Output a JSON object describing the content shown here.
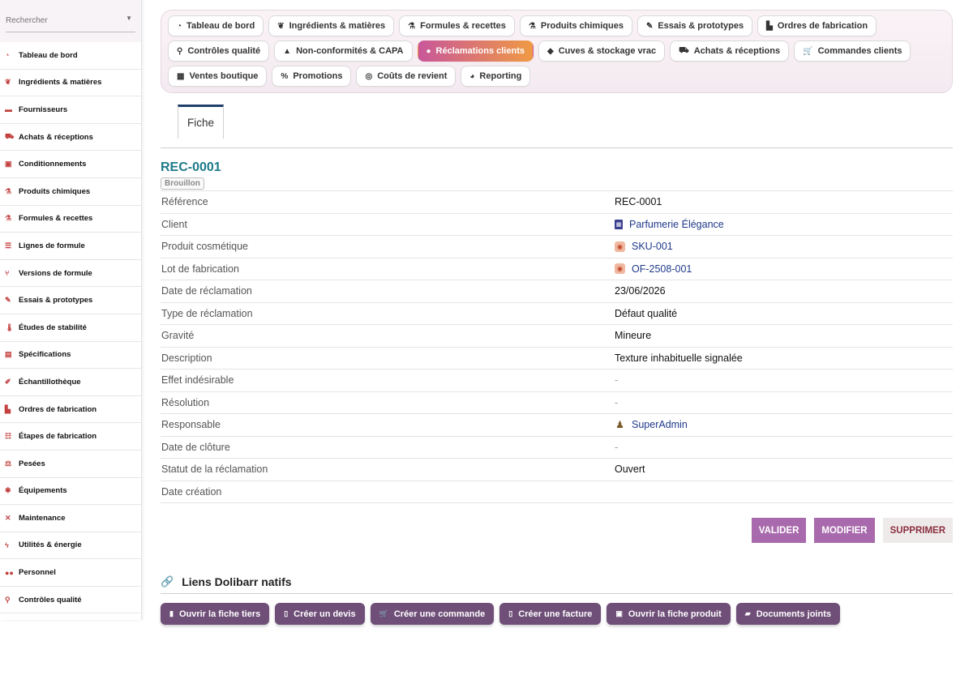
{
  "sidebar": {
    "search_placeholder": "Rechercher",
    "items": [
      {
        "label": "Tableau de bord",
        "icon": "dashboard-icon"
      },
      {
        "label": "Ingrédients & matières",
        "icon": "leaf-icon"
      },
      {
        "label": "Fournisseurs",
        "icon": "truck-icon"
      },
      {
        "label": "Achats & réceptions",
        "icon": "dolly-icon"
      },
      {
        "label": "Conditionnements",
        "icon": "box-icon"
      },
      {
        "label": "Produits chimiques",
        "icon": "flask-icon"
      },
      {
        "label": "Formules & recettes",
        "icon": "beaker-icon"
      },
      {
        "label": "Lignes de formule",
        "icon": "list-icon"
      },
      {
        "label": "Versions de formule",
        "icon": "branch-icon"
      },
      {
        "label": "Essais & prototypes",
        "icon": "eyedropper-icon"
      },
      {
        "label": "Études de stabilité",
        "icon": "thermometer-icon"
      },
      {
        "label": "Spécifications",
        "icon": "clipboard-icon"
      },
      {
        "label": "Échantillothèque",
        "icon": "vial-icon"
      },
      {
        "label": "Ordres de fabrication",
        "icon": "industry-icon"
      },
      {
        "label": "Étapes de fabrication",
        "icon": "steps-icon"
      },
      {
        "label": "Pesées",
        "icon": "scale-icon"
      },
      {
        "label": "Équipements",
        "icon": "cogs-icon"
      },
      {
        "label": "Maintenance",
        "icon": "tools-icon"
      },
      {
        "label": "Utilités & énergie",
        "icon": "bolt-icon"
      },
      {
        "label": "Personnel",
        "icon": "users-icon"
      },
      {
        "label": "Contrôles qualité",
        "icon": "microscope-icon"
      }
    ]
  },
  "tabs": {
    "row1": [
      {
        "label": "Tableau de bord",
        "icon": "dashboard-icon"
      },
      {
        "label": "Ingrédients & matières",
        "icon": "leaf-icon"
      },
      {
        "label": "Formules & recettes",
        "icon": "beaker-icon"
      },
      {
        "label": "Produits chimiques",
        "icon": "flask-icon"
      },
      {
        "label": "Essais & prototypes",
        "icon": "eyedropper-icon"
      },
      {
        "label": "Ordres de fabrication",
        "icon": "industry-icon"
      }
    ],
    "row2": [
      {
        "label": "Contrôles qualité",
        "icon": "microscope-icon"
      },
      {
        "label": "Non-conformités & CAPA",
        "icon": "warning-icon"
      },
      {
        "label": "Réclamations clients",
        "icon": "comment-icon",
        "active": true
      },
      {
        "label": "Cuves & stockage vrac",
        "icon": "fill-icon"
      },
      {
        "label": "Achats & réceptions",
        "icon": "dolly-icon"
      },
      {
        "label": "Commandes clients",
        "icon": "cart-icon"
      }
    ],
    "row3": [
      {
        "label": "Ventes boutique",
        "icon": "cash-register-icon"
      },
      {
        "label": "Promotions",
        "icon": "percent-icon"
      },
      {
        "label": "Coûts de revient",
        "icon": "coins-icon"
      },
      {
        "label": "Reporting",
        "icon": "pie-chart-icon"
      }
    ]
  },
  "card": {
    "tab_label": "Fiche",
    "ref_title": "REC-0001",
    "status": "Brouillon"
  },
  "fields": [
    {
      "label": "Référence",
      "value": "REC-0001",
      "kind": "text"
    },
    {
      "label": "Client",
      "value": "Parfumerie Élégance",
      "kind": "link",
      "icon": "building-icon"
    },
    {
      "label": "Produit cosmétique",
      "value": "SKU-001",
      "kind": "link",
      "icon": "product-icon"
    },
    {
      "label": "Lot de fabrication",
      "value": "OF-2508-001",
      "kind": "link",
      "icon": "product-icon"
    },
    {
      "label": "Date de réclamation",
      "value": "23/06/2026",
      "kind": "text"
    },
    {
      "label": "Type de réclamation",
      "value": "Défaut qualité",
      "kind": "text"
    },
    {
      "label": "Gravité",
      "value": "Mineure",
      "kind": "text"
    },
    {
      "label": "Description",
      "value": "Texture inhabituelle signalée",
      "kind": "text"
    },
    {
      "label": "Effet indésirable",
      "value": "-",
      "kind": "dash"
    },
    {
      "label": "Résolution",
      "value": "-",
      "kind": "dash"
    },
    {
      "label": "Responsable",
      "value": "SuperAdmin",
      "kind": "link",
      "icon": "user-icon"
    },
    {
      "label": "Date de clôture",
      "value": "-",
      "kind": "dash"
    },
    {
      "label": "Statut de la réclamation",
      "value": "Ouvert",
      "kind": "text"
    },
    {
      "label": "Date création",
      "value": "",
      "kind": "text"
    }
  ],
  "actions": {
    "validate": "VALIDER",
    "modify": "MODIFIER",
    "delete": "SUPPRIMER"
  },
  "native_links": {
    "title": "Liens Dolibarr natifs",
    "buttons": [
      {
        "label": "Ouvrir la fiche tiers",
        "icon": "building-icon"
      },
      {
        "label": "Créer un devis",
        "icon": "file-icon"
      },
      {
        "label": "Créer une commande",
        "icon": "cart-icon"
      },
      {
        "label": "Créer une facture",
        "icon": "invoice-icon"
      },
      {
        "label": "Ouvrir la fiche produit",
        "icon": "box-icon"
      },
      {
        "label": "Documents joints",
        "icon": "folder-icon"
      }
    ]
  },
  "colors": {
    "accent_gradient_start": "#c9579a",
    "accent_gradient_end": "#ef9a45",
    "ref_title": "#1e7a8a",
    "action_primary": "#a86aac",
    "link_button": "#6f4e78",
    "link_text": "#1f3a8a"
  }
}
